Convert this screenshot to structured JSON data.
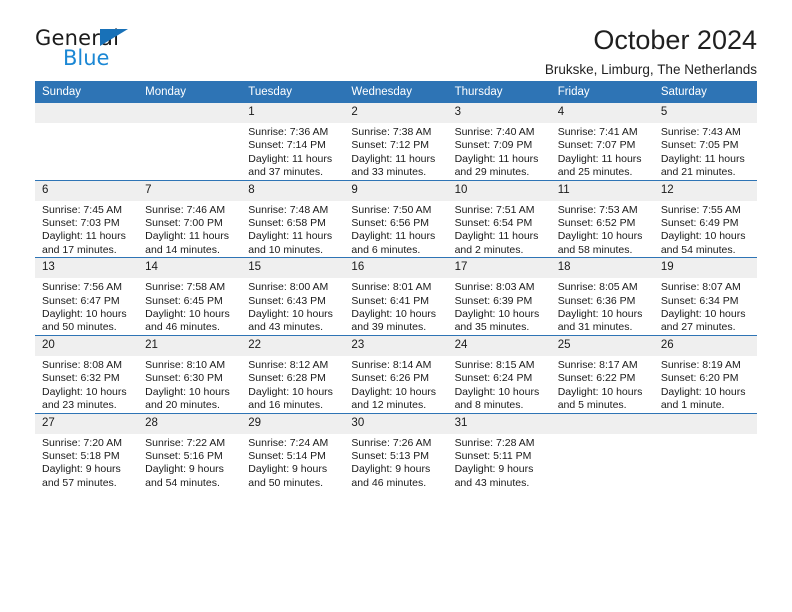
{
  "brand": {
    "name_part1": "General",
    "name_part2": "Blue",
    "triangle_color": "#1871b8",
    "blue_text_color": "#1b87d4"
  },
  "header": {
    "title": "October 2024",
    "subtitle": "Brukske, Limburg, The Netherlands"
  },
  "theme": {
    "header_blue": "#2e74b5",
    "daynum_band": "#efefef",
    "text": "#1a1a1a"
  },
  "weekday_headers": [
    "Sunday",
    "Monday",
    "Tuesday",
    "Wednesday",
    "Thursday",
    "Friday",
    "Saturday"
  ],
  "weeks": [
    [
      {
        "day": "",
        "sunrise": "",
        "sunset": "",
        "daylight1": "",
        "daylight2": ""
      },
      {
        "day": "",
        "sunrise": "",
        "sunset": "",
        "daylight1": "",
        "daylight2": ""
      },
      {
        "day": "1",
        "sunrise": "Sunrise: 7:36 AM",
        "sunset": "Sunset: 7:14 PM",
        "daylight1": "Daylight: 11 hours",
        "daylight2": "and 37 minutes."
      },
      {
        "day": "2",
        "sunrise": "Sunrise: 7:38 AM",
        "sunset": "Sunset: 7:12 PM",
        "daylight1": "Daylight: 11 hours",
        "daylight2": "and 33 minutes."
      },
      {
        "day": "3",
        "sunrise": "Sunrise: 7:40 AM",
        "sunset": "Sunset: 7:09 PM",
        "daylight1": "Daylight: 11 hours",
        "daylight2": "and 29 minutes."
      },
      {
        "day": "4",
        "sunrise": "Sunrise: 7:41 AM",
        "sunset": "Sunset: 7:07 PM",
        "daylight1": "Daylight: 11 hours",
        "daylight2": "and 25 minutes."
      },
      {
        "day": "5",
        "sunrise": "Sunrise: 7:43 AM",
        "sunset": "Sunset: 7:05 PM",
        "daylight1": "Daylight: 11 hours",
        "daylight2": "and 21 minutes."
      }
    ],
    [
      {
        "day": "6",
        "sunrise": "Sunrise: 7:45 AM",
        "sunset": "Sunset: 7:03 PM",
        "daylight1": "Daylight: 11 hours",
        "daylight2": "and 17 minutes."
      },
      {
        "day": "7",
        "sunrise": "Sunrise: 7:46 AM",
        "sunset": "Sunset: 7:00 PM",
        "daylight1": "Daylight: 11 hours",
        "daylight2": "and 14 minutes."
      },
      {
        "day": "8",
        "sunrise": "Sunrise: 7:48 AM",
        "sunset": "Sunset: 6:58 PM",
        "daylight1": "Daylight: 11 hours",
        "daylight2": "and 10 minutes."
      },
      {
        "day": "9",
        "sunrise": "Sunrise: 7:50 AM",
        "sunset": "Sunset: 6:56 PM",
        "daylight1": "Daylight: 11 hours",
        "daylight2": "and 6 minutes."
      },
      {
        "day": "10",
        "sunrise": "Sunrise: 7:51 AM",
        "sunset": "Sunset: 6:54 PM",
        "daylight1": "Daylight: 11 hours",
        "daylight2": "and 2 minutes."
      },
      {
        "day": "11",
        "sunrise": "Sunrise: 7:53 AM",
        "sunset": "Sunset: 6:52 PM",
        "daylight1": "Daylight: 10 hours",
        "daylight2": "and 58 minutes."
      },
      {
        "day": "12",
        "sunrise": "Sunrise: 7:55 AM",
        "sunset": "Sunset: 6:49 PM",
        "daylight1": "Daylight: 10 hours",
        "daylight2": "and 54 minutes."
      }
    ],
    [
      {
        "day": "13",
        "sunrise": "Sunrise: 7:56 AM",
        "sunset": "Sunset: 6:47 PM",
        "daylight1": "Daylight: 10 hours",
        "daylight2": "and 50 minutes."
      },
      {
        "day": "14",
        "sunrise": "Sunrise: 7:58 AM",
        "sunset": "Sunset: 6:45 PM",
        "daylight1": "Daylight: 10 hours",
        "daylight2": "and 46 minutes."
      },
      {
        "day": "15",
        "sunrise": "Sunrise: 8:00 AM",
        "sunset": "Sunset: 6:43 PM",
        "daylight1": "Daylight: 10 hours",
        "daylight2": "and 43 minutes."
      },
      {
        "day": "16",
        "sunrise": "Sunrise: 8:01 AM",
        "sunset": "Sunset: 6:41 PM",
        "daylight1": "Daylight: 10 hours",
        "daylight2": "and 39 minutes."
      },
      {
        "day": "17",
        "sunrise": "Sunrise: 8:03 AM",
        "sunset": "Sunset: 6:39 PM",
        "daylight1": "Daylight: 10 hours",
        "daylight2": "and 35 minutes."
      },
      {
        "day": "18",
        "sunrise": "Sunrise: 8:05 AM",
        "sunset": "Sunset: 6:36 PM",
        "daylight1": "Daylight: 10 hours",
        "daylight2": "and 31 minutes."
      },
      {
        "day": "19",
        "sunrise": "Sunrise: 8:07 AM",
        "sunset": "Sunset: 6:34 PM",
        "daylight1": "Daylight: 10 hours",
        "daylight2": "and 27 minutes."
      }
    ],
    [
      {
        "day": "20",
        "sunrise": "Sunrise: 8:08 AM",
        "sunset": "Sunset: 6:32 PM",
        "daylight1": "Daylight: 10 hours",
        "daylight2": "and 23 minutes."
      },
      {
        "day": "21",
        "sunrise": "Sunrise: 8:10 AM",
        "sunset": "Sunset: 6:30 PM",
        "daylight1": "Daylight: 10 hours",
        "daylight2": "and 20 minutes."
      },
      {
        "day": "22",
        "sunrise": "Sunrise: 8:12 AM",
        "sunset": "Sunset: 6:28 PM",
        "daylight1": "Daylight: 10 hours",
        "daylight2": "and 16 minutes."
      },
      {
        "day": "23",
        "sunrise": "Sunrise: 8:14 AM",
        "sunset": "Sunset: 6:26 PM",
        "daylight1": "Daylight: 10 hours",
        "daylight2": "and 12 minutes."
      },
      {
        "day": "24",
        "sunrise": "Sunrise: 8:15 AM",
        "sunset": "Sunset: 6:24 PM",
        "daylight1": "Daylight: 10 hours",
        "daylight2": "and 8 minutes."
      },
      {
        "day": "25",
        "sunrise": "Sunrise: 8:17 AM",
        "sunset": "Sunset: 6:22 PM",
        "daylight1": "Daylight: 10 hours",
        "daylight2": "and 5 minutes."
      },
      {
        "day": "26",
        "sunrise": "Sunrise: 8:19 AM",
        "sunset": "Sunset: 6:20 PM",
        "daylight1": "Daylight: 10 hours",
        "daylight2": "and 1 minute."
      }
    ],
    [
      {
        "day": "27",
        "sunrise": "Sunrise: 7:20 AM",
        "sunset": "Sunset: 5:18 PM",
        "daylight1": "Daylight: 9 hours",
        "daylight2": "and 57 minutes."
      },
      {
        "day": "28",
        "sunrise": "Sunrise: 7:22 AM",
        "sunset": "Sunset: 5:16 PM",
        "daylight1": "Daylight: 9 hours",
        "daylight2": "and 54 minutes."
      },
      {
        "day": "29",
        "sunrise": "Sunrise: 7:24 AM",
        "sunset": "Sunset: 5:14 PM",
        "daylight1": "Daylight: 9 hours",
        "daylight2": "and 50 minutes."
      },
      {
        "day": "30",
        "sunrise": "Sunrise: 7:26 AM",
        "sunset": "Sunset: 5:13 PM",
        "daylight1": "Daylight: 9 hours",
        "daylight2": "and 46 minutes."
      },
      {
        "day": "31",
        "sunrise": "Sunrise: 7:28 AM",
        "sunset": "Sunset: 5:11 PM",
        "daylight1": "Daylight: 9 hours",
        "daylight2": "and 43 minutes."
      },
      {
        "day": "",
        "sunrise": "",
        "sunset": "",
        "daylight1": "",
        "daylight2": ""
      },
      {
        "day": "",
        "sunrise": "",
        "sunset": "",
        "daylight1": "",
        "daylight2": ""
      }
    ]
  ]
}
